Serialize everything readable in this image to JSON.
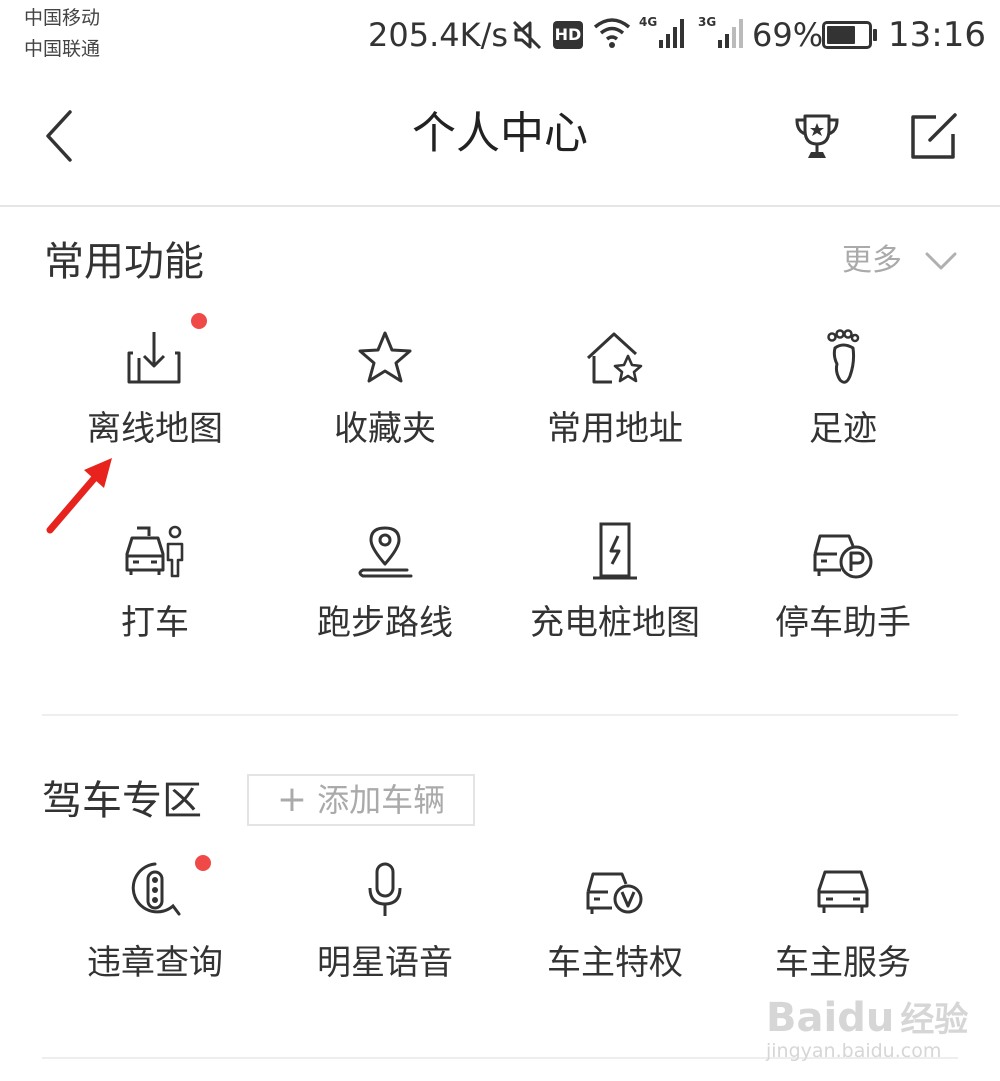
{
  "status_bar": {
    "carrier1": "中国移动",
    "carrier2": "中国联通",
    "speed": "205.4K/s",
    "hd": "HD",
    "net1": "4G",
    "net2": "3G",
    "battery": "69%",
    "battery_level": 0.69,
    "time": "13:16"
  },
  "header": {
    "title": "个人中心"
  },
  "common": {
    "title": "常用功能",
    "more": "更多",
    "items": [
      {
        "label": "离线地图",
        "icon": "offline-map-icon",
        "badge": true
      },
      {
        "label": "收藏夹",
        "icon": "star-icon"
      },
      {
        "label": "常用地址",
        "icon": "home-star-icon"
      },
      {
        "label": "足迹",
        "icon": "footprint-icon"
      },
      {
        "label": "打车",
        "icon": "taxi-icon"
      },
      {
        "label": "跑步路线",
        "icon": "location-pin-icon"
      },
      {
        "label": "充电桩地图",
        "icon": "charging-pile-icon"
      },
      {
        "label": "停车助手",
        "icon": "parking-icon"
      }
    ]
  },
  "driving": {
    "title": "驾车专区",
    "add_vehicle": "添加车辆",
    "items": [
      {
        "label": "违章查询",
        "icon": "traffic-light-icon",
        "badge": true
      },
      {
        "label": "明星语音",
        "icon": "microphone-icon"
      },
      {
        "label": "车主特权",
        "icon": "car-vip-icon"
      },
      {
        "label": "车主服务",
        "icon": "car-icon"
      }
    ]
  },
  "watermark": {
    "brand": "Baidu",
    "cn": "经验",
    "url": "jingyan.baidu.com"
  },
  "colors": {
    "accent_red": "#f04a48",
    "arrow_red": "#e8231d",
    "text": "#333333",
    "muted": "#aaaaaa"
  }
}
